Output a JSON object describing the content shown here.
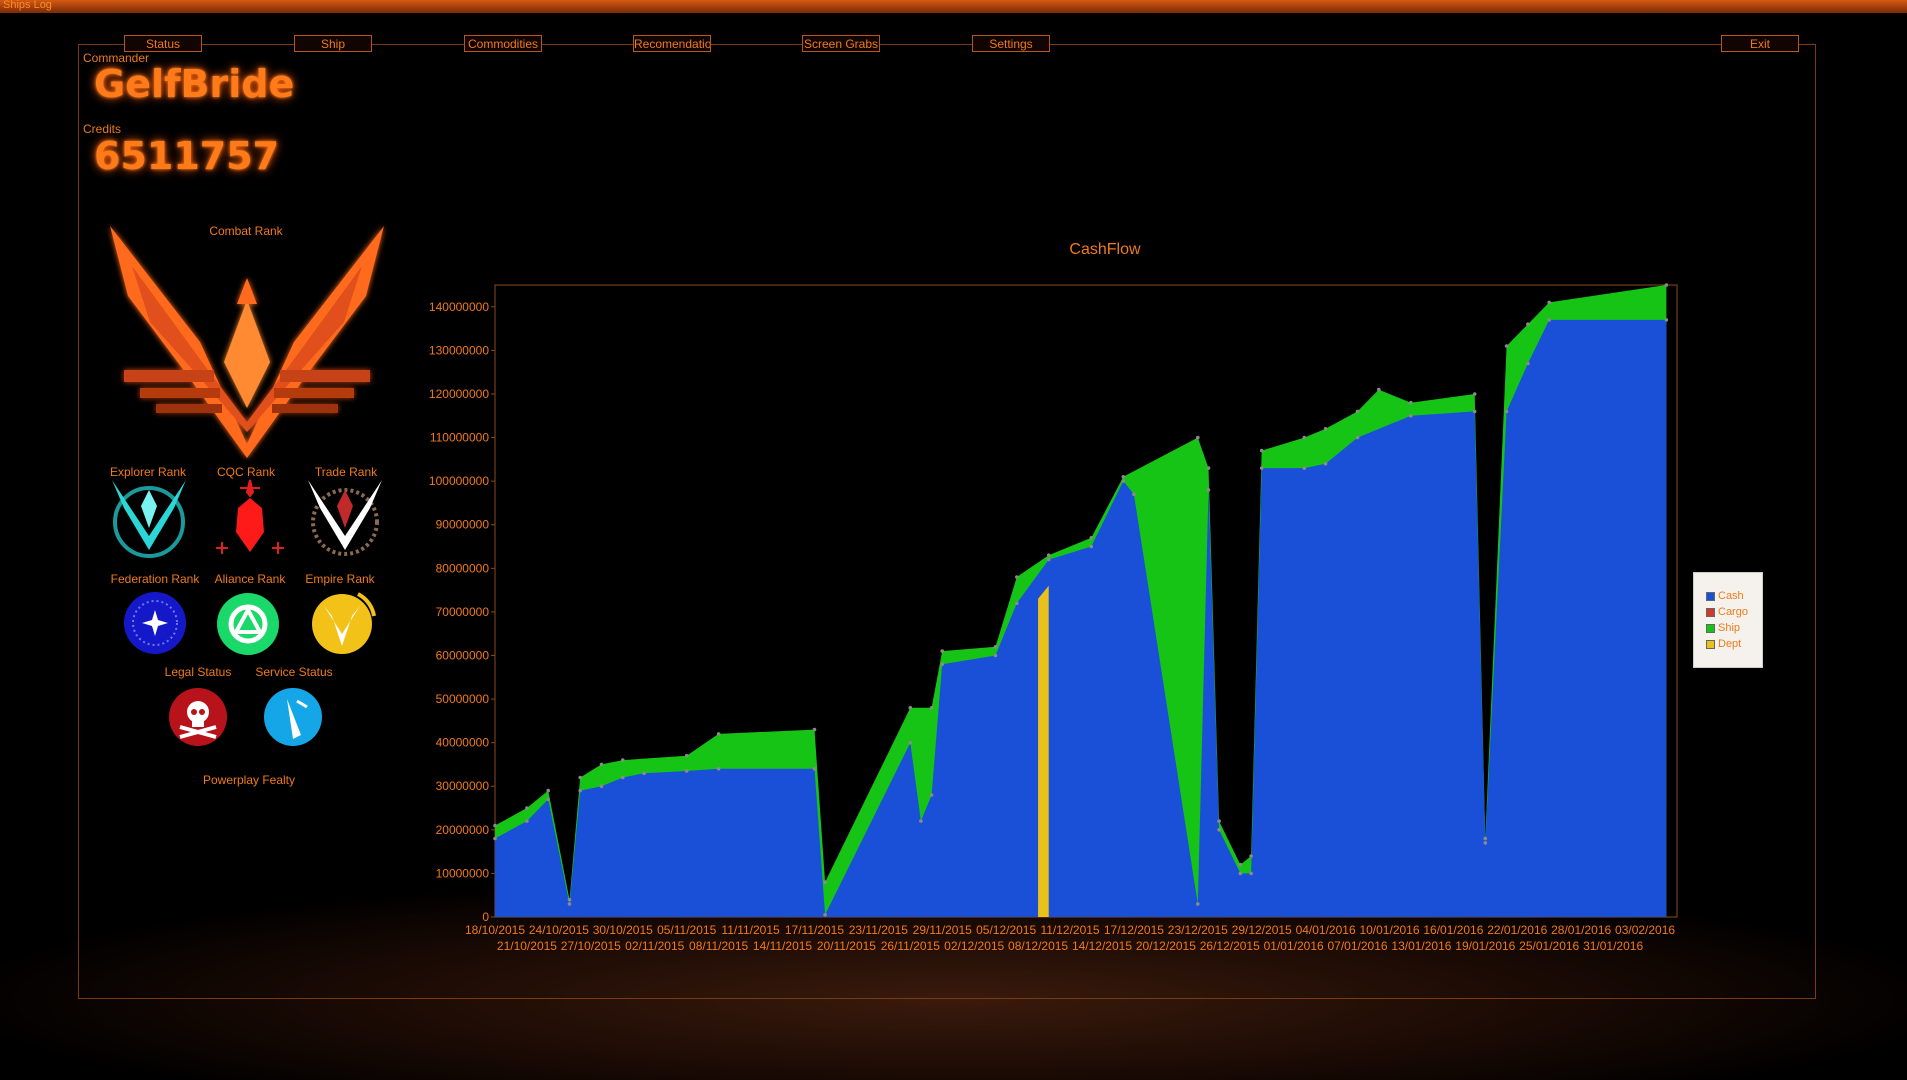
{
  "window": {
    "title": "Ships Log"
  },
  "nav": {
    "status": "Status",
    "ship": "Ship",
    "commodities": "Commodities",
    "recommendation": "Recomendatio",
    "screen_grabs": "Screen Grabs",
    "settings": "Settings",
    "exit": "Exit"
  },
  "commander": {
    "label": "Commander",
    "name": "GelfBride"
  },
  "credits": {
    "label": "Credits",
    "value": "6511757"
  },
  "ranks": {
    "combat": "Combat Rank",
    "explorer": "Explorer Rank",
    "cqc": "CQC Rank",
    "trade": "Trade Rank",
    "federation": "Federation Rank",
    "alliance": "Aliance Rank",
    "empire": "Empire Rank",
    "legal": "Legal Status",
    "service": "Service Status",
    "powerplay": "Powerplay Fealty"
  },
  "colors": {
    "accent": "#f07a1a",
    "cash": "#1a50d8",
    "cargo": "#cc3b2b",
    "ship": "#16c416",
    "dept": "#e8c21a"
  },
  "chart_data": {
    "type": "area",
    "title": "CashFlow",
    "ylim": [
      0,
      145000000
    ],
    "y_ticks": [
      "140000000",
      "130000000",
      "120000000",
      "110000000",
      "100000000",
      "90000000",
      "80000000",
      "70000000",
      "60000000",
      "50000000",
      "40000000",
      "30000000",
      "20000000",
      "10000000",
      "0"
    ],
    "x_ticks_row1": [
      "18/10/2015",
      "24/10/2015",
      "30/10/2015",
      "05/11/2015",
      "11/11/2015",
      "17/11/2015",
      "23/11/2015",
      "29/11/2015",
      "05/12/2015",
      "11/12/2015",
      "17/12/2015",
      "23/12/2015",
      "29/12/2015",
      "04/01/2016",
      "10/01/2016",
      "16/01/2016",
      "22/01/2016",
      "28/01/2016",
      "03/02/2016"
    ],
    "x_ticks_row2": [
      "21/10/2015",
      "27/10/2015",
      "02/11/2015",
      "08/11/2015",
      "14/11/2015",
      "20/11/2015",
      "26/11/2015",
      "02/12/2015",
      "08/12/2015",
      "14/12/2015",
      "20/12/2015",
      "26/12/2015",
      "01/01/2016",
      "07/01/2016",
      "13/01/2016",
      "19/01/2016",
      "25/01/2016",
      "31/01/2016"
    ],
    "x_start": "18/10/2015",
    "x_end": "06/02/2016",
    "legend": [
      "Cash",
      "Cargo",
      "Ship",
      "Dept"
    ],
    "legend_position": "right",
    "series": [
      {
        "name": "Cash",
        "points": [
          [
            "18/10/2015",
            18000000
          ],
          [
            "21/10/2015",
            22000000
          ],
          [
            "23/10/2015",
            27000000
          ],
          [
            "25/10/2015",
            3000000
          ],
          [
            "26/10/2015",
            29000000
          ],
          [
            "28/10/2015",
            30000000
          ],
          [
            "30/10/2015",
            32000000
          ],
          [
            "01/11/2015",
            33000000
          ],
          [
            "05/11/2015",
            33500000
          ],
          [
            "08/11/2015",
            34000000
          ],
          [
            "17/11/2015",
            34000000
          ],
          [
            "18/11/2015",
            500000
          ],
          [
            "26/11/2015",
            40000000
          ],
          [
            "27/11/2015",
            22000000
          ],
          [
            "28/11/2015",
            28000000
          ],
          [
            "29/11/2015",
            58000000
          ],
          [
            "04/12/2015",
            60000000
          ],
          [
            "06/12/2015",
            72000000
          ],
          [
            "09/12/2015",
            82000000
          ],
          [
            "13/12/2015",
            85000000
          ],
          [
            "16/12/2015",
            100000000
          ],
          [
            "17/12/2015",
            97000000
          ],
          [
            "23/12/2015",
            3000000
          ],
          [
            "24/12/2015",
            98000000
          ],
          [
            "25/12/2015",
            20000000
          ],
          [
            "27/12/2015",
            10000000
          ],
          [
            "28/12/2015",
            10000000
          ],
          [
            "29/12/2015",
            103000000
          ],
          [
            "02/01/2016",
            103000000
          ],
          [
            "04/01/2016",
            104000000
          ],
          [
            "07/01/2016",
            110000000
          ],
          [
            "12/01/2016",
            115000000
          ],
          [
            "18/01/2016",
            116000000
          ],
          [
            "19/01/2016",
            17000000
          ],
          [
            "21/01/2016",
            116000000
          ],
          [
            "23/01/2016",
            127000000
          ],
          [
            "25/01/2016",
            137000000
          ],
          [
            "05/02/2016",
            137000000
          ]
        ]
      },
      {
        "name": "Cargo",
        "points": []
      },
      {
        "name": "Ship",
        "points": [
          [
            "18/10/2015",
            21000000
          ],
          [
            "21/10/2015",
            25000000
          ],
          [
            "23/10/2015",
            29000000
          ],
          [
            "25/10/2015",
            4000000
          ],
          [
            "26/10/2015",
            32000000
          ],
          [
            "28/10/2015",
            35000000
          ],
          [
            "30/10/2015",
            36000000
          ],
          [
            "05/11/2015",
            37000000
          ],
          [
            "08/11/2015",
            42000000
          ],
          [
            "17/11/2015",
            43000000
          ],
          [
            "18/11/2015",
            8000000
          ],
          [
            "26/11/2015",
            48000000
          ],
          [
            "28/11/2015",
            48000000
          ],
          [
            "29/11/2015",
            61000000
          ],
          [
            "04/12/2015",
            62000000
          ],
          [
            "06/12/2015",
            78000000
          ],
          [
            "09/12/2015",
            83000000
          ],
          [
            "13/12/2015",
            87000000
          ],
          [
            "16/12/2015",
            101000000
          ],
          [
            "23/12/2015",
            110000000
          ],
          [
            "24/12/2015",
            103000000
          ],
          [
            "25/12/2015",
            22000000
          ],
          [
            "27/12/2015",
            12000000
          ],
          [
            "28/12/2015",
            14000000
          ],
          [
            "29/12/2015",
            107000000
          ],
          [
            "02/01/2016",
            110000000
          ],
          [
            "04/01/2016",
            112000000
          ],
          [
            "07/01/2016",
            116000000
          ],
          [
            "09/01/2016",
            121000000
          ],
          [
            "12/01/2016",
            118000000
          ],
          [
            "18/01/2016",
            120000000
          ],
          [
            "19/01/2016",
            18000000
          ],
          [
            "21/01/2016",
            131000000
          ],
          [
            "23/01/2016",
            136000000
          ],
          [
            "25/01/2016",
            141000000
          ],
          [
            "05/02/2016",
            145000000
          ]
        ]
      },
      {
        "name": "Dept",
        "points": [
          [
            "08/12/2015",
            73000000
          ],
          [
            "09/12/2015",
            76000000
          ]
        ]
      }
    ]
  }
}
